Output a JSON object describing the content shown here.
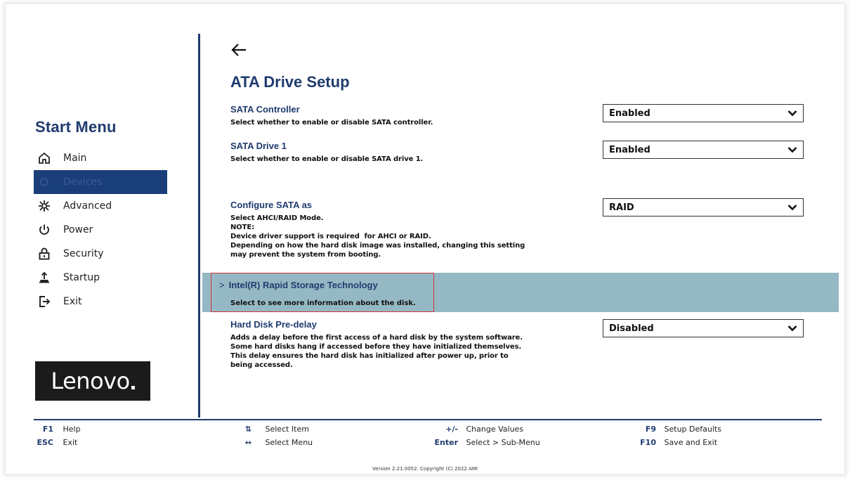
{
  "sidebar": {
    "title": "Start Menu",
    "items": [
      {
        "label": "Main",
        "icon": "home-icon",
        "active": false
      },
      {
        "label": "Devices",
        "icon": "devices-icon",
        "active": true
      },
      {
        "label": "Advanced",
        "icon": "advanced-icon",
        "active": false
      },
      {
        "label": "Power",
        "icon": "power-icon",
        "active": false
      },
      {
        "label": "Security",
        "icon": "lock-icon",
        "active": false
      },
      {
        "label": "Startup",
        "icon": "startup-icon",
        "active": false
      },
      {
        "label": "Exit",
        "icon": "exit-icon",
        "active": false
      }
    ],
    "logo": "Lenovo",
    "active_color": "#1a3e7a"
  },
  "main": {
    "title": "ATA Drive Setup",
    "settings": [
      {
        "label": "SATA Controller",
        "desc": [
          "Select whether to enable or disable SATA controller."
        ],
        "value": "Enabled"
      },
      {
        "label": "SATA Drive 1",
        "desc": [
          "Select whether to enable or disable SATA drive 1."
        ],
        "value": "Enabled"
      },
      {
        "label": "Configure SATA as",
        "desc": [
          "Select AHCI/RAID Mode.",
          "NOTE:",
          "Device driver support is required  for AHCI or RAID.",
          "Depending on how the hard disk image was installed, changing this setting",
          "may prevent the system from booting."
        ],
        "value": "RAID"
      },
      {
        "label": "Hard Disk Pre-delay",
        "desc": [
          "Adds a delay before the first access of a hard disk by the system software.",
          "Some hard disks hang if accessed before they have initialized themselves.",
          "This delay ensures the hard disk has initialized after power up, prior to",
          "being accessed."
        ],
        "value": "Disabled"
      }
    ],
    "submenu": {
      "chevron": ">",
      "label": "Intel(R) Rapid Storage Technology",
      "desc": "Select to see more information about the disk.",
      "highlight_color": "#95b9c4",
      "box_color": "#d0343a"
    }
  },
  "footer": {
    "keys": [
      {
        "key": "F1",
        "action": "Help"
      },
      {
        "key": "ESC",
        "action": "Exit"
      },
      {
        "key": "⇅",
        "action": "Select Item"
      },
      {
        "key": "↔",
        "action": "Select Menu"
      },
      {
        "key": "+/-",
        "action": "Change Values"
      },
      {
        "key": "Enter",
        "action": "Select > Sub-Menu"
      },
      {
        "key": "F9",
        "action": "Setup Defaults"
      },
      {
        "key": "F10",
        "action": "Save and Exit"
      }
    ],
    "version": "Version 2.21.0052. Copyright (C) 2022 AMI"
  },
  "colors": {
    "accent": "#1f3b6e"
  }
}
